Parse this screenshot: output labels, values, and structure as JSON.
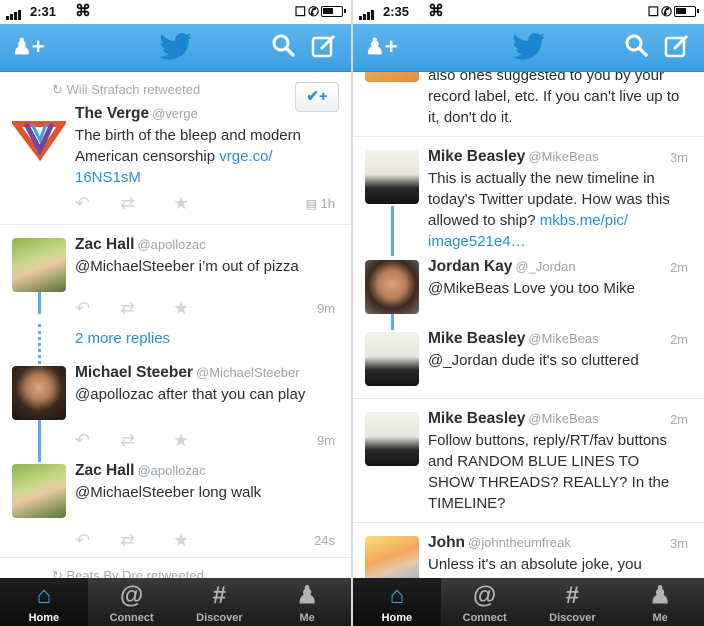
{
  "left": {
    "status": {
      "time": "2:31"
    },
    "retweet_by": "Will Strafach retweeted",
    "tweets": [
      {
        "name": "The Verge",
        "handle": "@verge",
        "text": "The birth of the bleep and modern American censorship ",
        "link": "vrge.co/ 16NS1sM",
        "time": "1h"
      },
      {
        "name": "Zac Hall",
        "handle": "@apollozac",
        "text": "@MichaelSteeber i’m out of pizza",
        "time": "9m"
      },
      {
        "name": "Michael Steeber",
        "handle": "@MichaelSteeber",
        "text": "@apollozac after that you can play",
        "time": "9m"
      },
      {
        "name": "Zac Hall",
        "handle": "@apollozac",
        "text": "@MichaelSteeber long walk",
        "time": "24s"
      }
    ],
    "more_replies": "2 more replies",
    "partial_retweet": "Beats By Dre retweeted"
  },
  "right": {
    "status": {
      "time": "2:35"
    },
    "top_text": "also ones suggested to you by your record label, etc. If you can't live up to it, don't do it.",
    "tweets": [
      {
        "name": "Mike Beasley",
        "handle": "@MikeBeas",
        "text": "This is actually the new timeline in today's Twitter update. How was this allowed to ship? ",
        "link": "mkbs.me/pic/ image521e4…",
        "time": "3m"
      },
      {
        "name": "Jordan Kay",
        "handle": "@_Jordan",
        "text": "@MikeBeas Love you too Mike",
        "time": "2m"
      },
      {
        "name": "Mike Beasley",
        "handle": "@MikeBeas",
        "text": "@_Jordan dude it's so cluttered",
        "time": "2m"
      },
      {
        "name": "Mike Beasley",
        "handle": "@MikeBeas",
        "text": "Follow buttons, reply/RT/fav buttons and RANDOM BLUE LINES TO SHOW THREADS? REALLY? In the TIMELINE?",
        "time": "2m"
      },
      {
        "name": "John",
        "handle": "@johntheumfreak",
        "text": "Unless it's an absolute joke, you",
        "time": "3m"
      }
    ]
  },
  "tabs": [
    {
      "label": "Home",
      "icon": "home-icon"
    },
    {
      "label": "Connect",
      "icon": "at-icon"
    },
    {
      "label": "Discover",
      "icon": "hash-icon"
    },
    {
      "label": "Me",
      "icon": "person-icon"
    }
  ],
  "colors": {
    "nav": "#3a9fe3",
    "link": "#2a8ed8",
    "thread": "#5aacec",
    "tab_active": "#38a6ec"
  }
}
